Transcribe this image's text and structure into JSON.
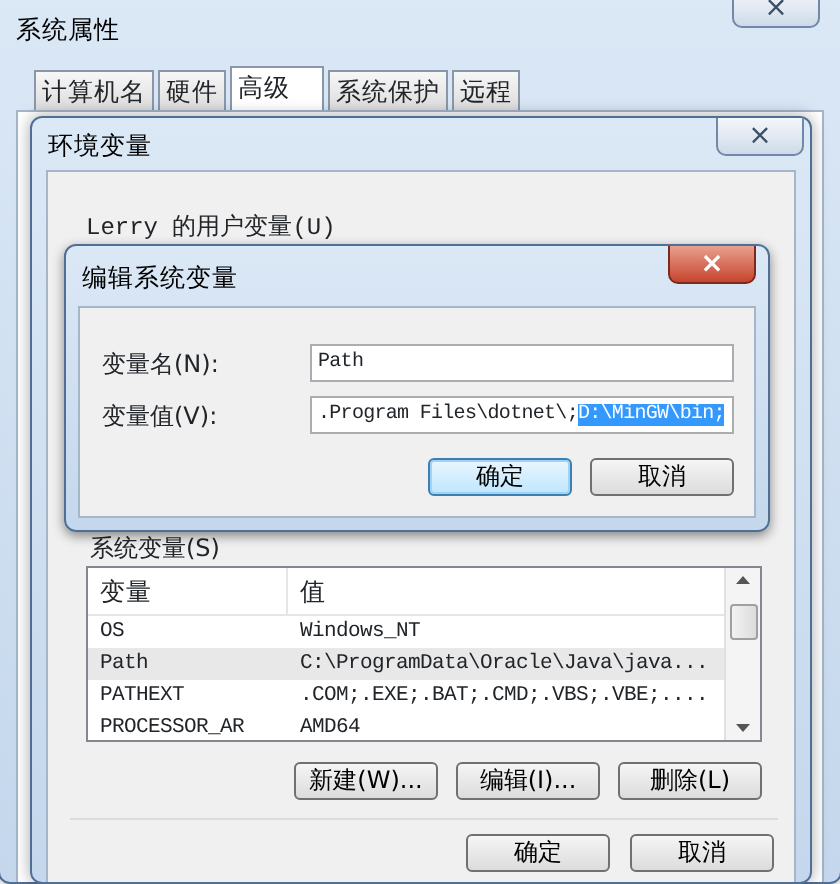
{
  "system_properties": {
    "title": "系统属性",
    "close": "×",
    "tabs": [
      {
        "label": "计算机名",
        "selected": false
      },
      {
        "label": "硬件",
        "selected": false
      },
      {
        "label": "高级",
        "selected": true
      },
      {
        "label": "系统保护",
        "selected": false
      },
      {
        "label": "远程",
        "selected": false
      }
    ]
  },
  "environment_variables": {
    "title": "环境变量",
    "close": "×",
    "user_group_label": "Lerry 的用户变量(U)",
    "system_group_label": "系统变量(S)",
    "system_table": {
      "columns": [
        "变量",
        "值"
      ],
      "rows": [
        {
          "cells": [
            "OS",
            "Windows_NT"
          ],
          "selected": false
        },
        {
          "cells": [
            "Path",
            "C:\\ProgramData\\Oracle\\Java\\java..."
          ],
          "selected": true
        },
        {
          "cells": [
            "PATHEXT",
            ".COM;.EXE;.BAT;.CMD;.VBS;.VBE;...."
          ],
          "selected": false
        },
        {
          "cells": [
            "PROCESSOR_AR",
            "AMD64"
          ],
          "selected": false
        }
      ]
    },
    "system_buttons": [
      "新建(W)...",
      "编辑(I)...",
      "删除(L)"
    ],
    "buttons": [
      "确定",
      "取消"
    ]
  },
  "edit_dialog": {
    "title": "编辑系统变量",
    "close": "×",
    "name_label": "变量名(N):",
    "name_value": "Path",
    "value_label": "变量值(V):",
    "value_text": ".Program Files\\dotnet\\;",
    "value_selected_text": "D:\\MinGW\\bin;",
    "buttons": [
      {
        "label": "确定",
        "default": true
      },
      {
        "label": "取消",
        "default": false
      }
    ]
  }
}
